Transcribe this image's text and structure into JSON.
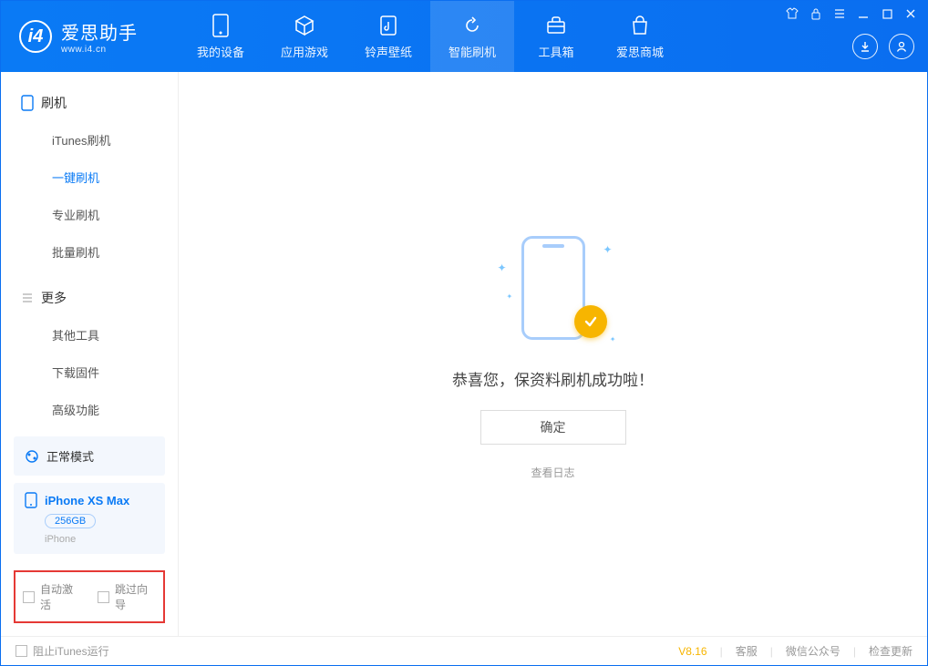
{
  "app": {
    "title": "爱思助手",
    "subtitle": "www.i4.cn"
  },
  "tabs": {
    "device": "我的设备",
    "apps": "应用游戏",
    "wallpaper": "铃声壁纸",
    "flash": "智能刷机",
    "toolbox": "工具箱",
    "store": "爱思商城"
  },
  "sidebar": {
    "group_flash": "刷机",
    "items_flash": {
      "itunes": "iTunes刷机",
      "onekey": "一键刷机",
      "pro": "专业刷机",
      "batch": "批量刷机"
    },
    "group_more": "更多",
    "items_more": {
      "other": "其他工具",
      "firmware": "下载固件",
      "advanced": "高级功能"
    },
    "mode": "正常模式",
    "device": {
      "name": "iPhone XS Max",
      "capacity": "256GB",
      "type": "iPhone"
    },
    "footer": {
      "auto_activate": "自动激活",
      "skip_guide": "跳过向导"
    }
  },
  "main": {
    "message": "恭喜您，保资料刷机成功啦！",
    "ok": "确定",
    "view_log": "查看日志"
  },
  "status": {
    "block_itunes": "阻止iTunes运行",
    "version": "V8.16",
    "support": "客服",
    "wechat": "微信公众号",
    "update": "检查更新"
  }
}
